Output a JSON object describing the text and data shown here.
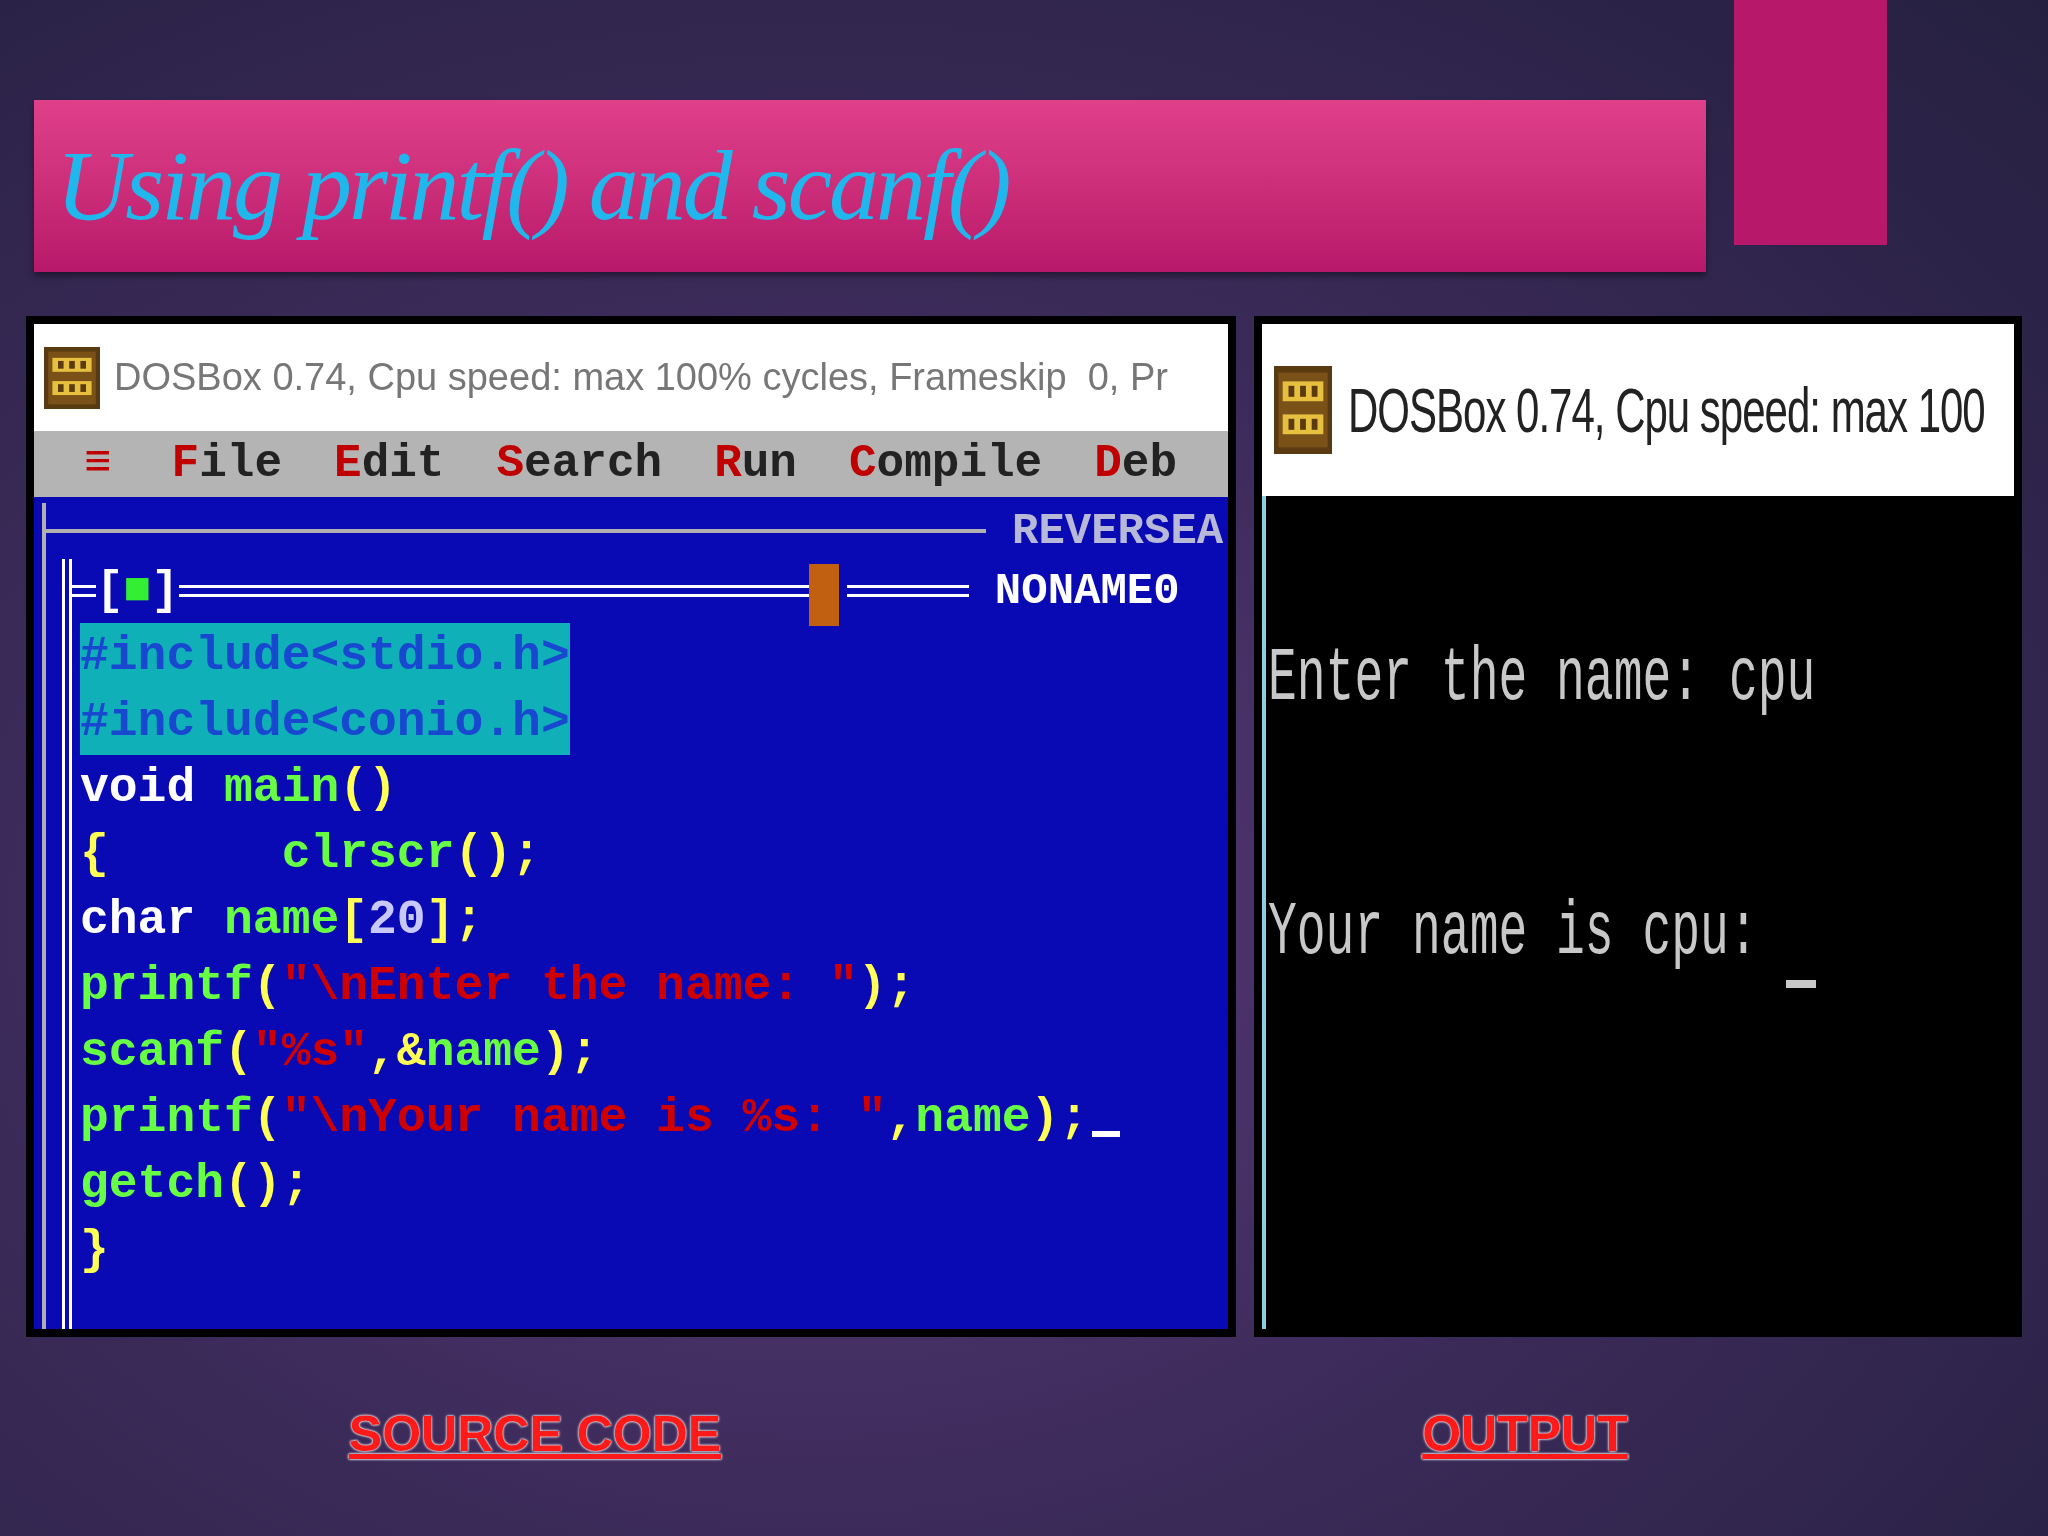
{
  "slide_title": "Using printf() and scanf()",
  "source_window": {
    "title": "DOSBox 0.74, Cpu speed: max 100% cycles, Frameskip  0, Pr",
    "menu": [
      {
        "label": "≡",
        "kind": "system"
      },
      {
        "label": "File",
        "kind": "menu"
      },
      {
        "label": "Edit",
        "kind": "menu"
      },
      {
        "label": "Search",
        "kind": "menu"
      },
      {
        "label": "Run",
        "kind": "menu"
      },
      {
        "label": "Compile",
        "kind": "menu"
      },
      {
        "label": "Deb",
        "kind": "menu"
      }
    ],
    "back_window_name": "REVERSEA",
    "close_box": "[■]",
    "window_name": "NONAME0",
    "code_lines": [
      {
        "selected": true,
        "cursor": false,
        "segments": [
          {
            "kind": "preproc",
            "text": "#include<stdio.h>"
          }
        ]
      },
      {
        "selected": true,
        "cursor": false,
        "segments": [
          {
            "kind": "preproc",
            "text": "#include<conio.h>"
          }
        ]
      },
      {
        "selected": false,
        "cursor": false,
        "segments": [
          {
            "kind": "keyword",
            "text": "void "
          },
          {
            "kind": "ident",
            "text": "main"
          },
          {
            "kind": "symbol",
            "text": "()"
          }
        ]
      },
      {
        "selected": false,
        "cursor": false,
        "segments": [
          {
            "kind": "symbol",
            "text": "{      "
          },
          {
            "kind": "ident",
            "text": "clrscr"
          },
          {
            "kind": "symbol",
            "text": "();"
          }
        ]
      },
      {
        "selected": false,
        "cursor": false,
        "segments": [
          {
            "kind": "keyword",
            "text": "char "
          },
          {
            "kind": "ident",
            "text": "name"
          },
          {
            "kind": "symbol",
            "text": "["
          },
          {
            "kind": "number",
            "text": "20"
          },
          {
            "kind": "symbol",
            "text": "];"
          }
        ]
      },
      {
        "selected": false,
        "cursor": false,
        "segments": [
          {
            "kind": "ident",
            "text": "printf"
          },
          {
            "kind": "symbol",
            "text": "("
          },
          {
            "kind": "string",
            "text": "\"\\nEnter the name: \""
          },
          {
            "kind": "symbol",
            "text": ");"
          }
        ]
      },
      {
        "selected": false,
        "cursor": false,
        "segments": [
          {
            "kind": "ident",
            "text": "scanf"
          },
          {
            "kind": "symbol",
            "text": "("
          },
          {
            "kind": "string",
            "text": "\"%s\""
          },
          {
            "kind": "symbol",
            "text": ",&"
          },
          {
            "kind": "ident",
            "text": "name"
          },
          {
            "kind": "symbol",
            "text": ");"
          }
        ]
      },
      {
        "selected": false,
        "cursor": true,
        "segments": [
          {
            "kind": "ident",
            "text": "printf"
          },
          {
            "kind": "symbol",
            "text": "("
          },
          {
            "kind": "string",
            "text": "\"\\nYour name is %s: \""
          },
          {
            "kind": "symbol",
            "text": ","
          },
          {
            "kind": "ident",
            "text": "name"
          },
          {
            "kind": "symbol",
            "text": ");"
          }
        ]
      },
      {
        "selected": false,
        "cursor": false,
        "segments": [
          {
            "kind": "ident",
            "text": "getch"
          },
          {
            "kind": "symbol",
            "text": "();"
          }
        ]
      },
      {
        "selected": false,
        "cursor": false,
        "segments": [
          {
            "kind": "symbol",
            "text": "}"
          }
        ]
      }
    ]
  },
  "output_window": {
    "title": "DOSBox 0.74, Cpu speed: max 100",
    "lines": [
      {
        "text": "Enter the name: cpu",
        "cursor": false
      },
      {
        "text": "Your name is cpu: ",
        "cursor": true
      }
    ]
  },
  "captions": [
    "SOURCE CODE",
    "OUTPUT"
  ]
}
